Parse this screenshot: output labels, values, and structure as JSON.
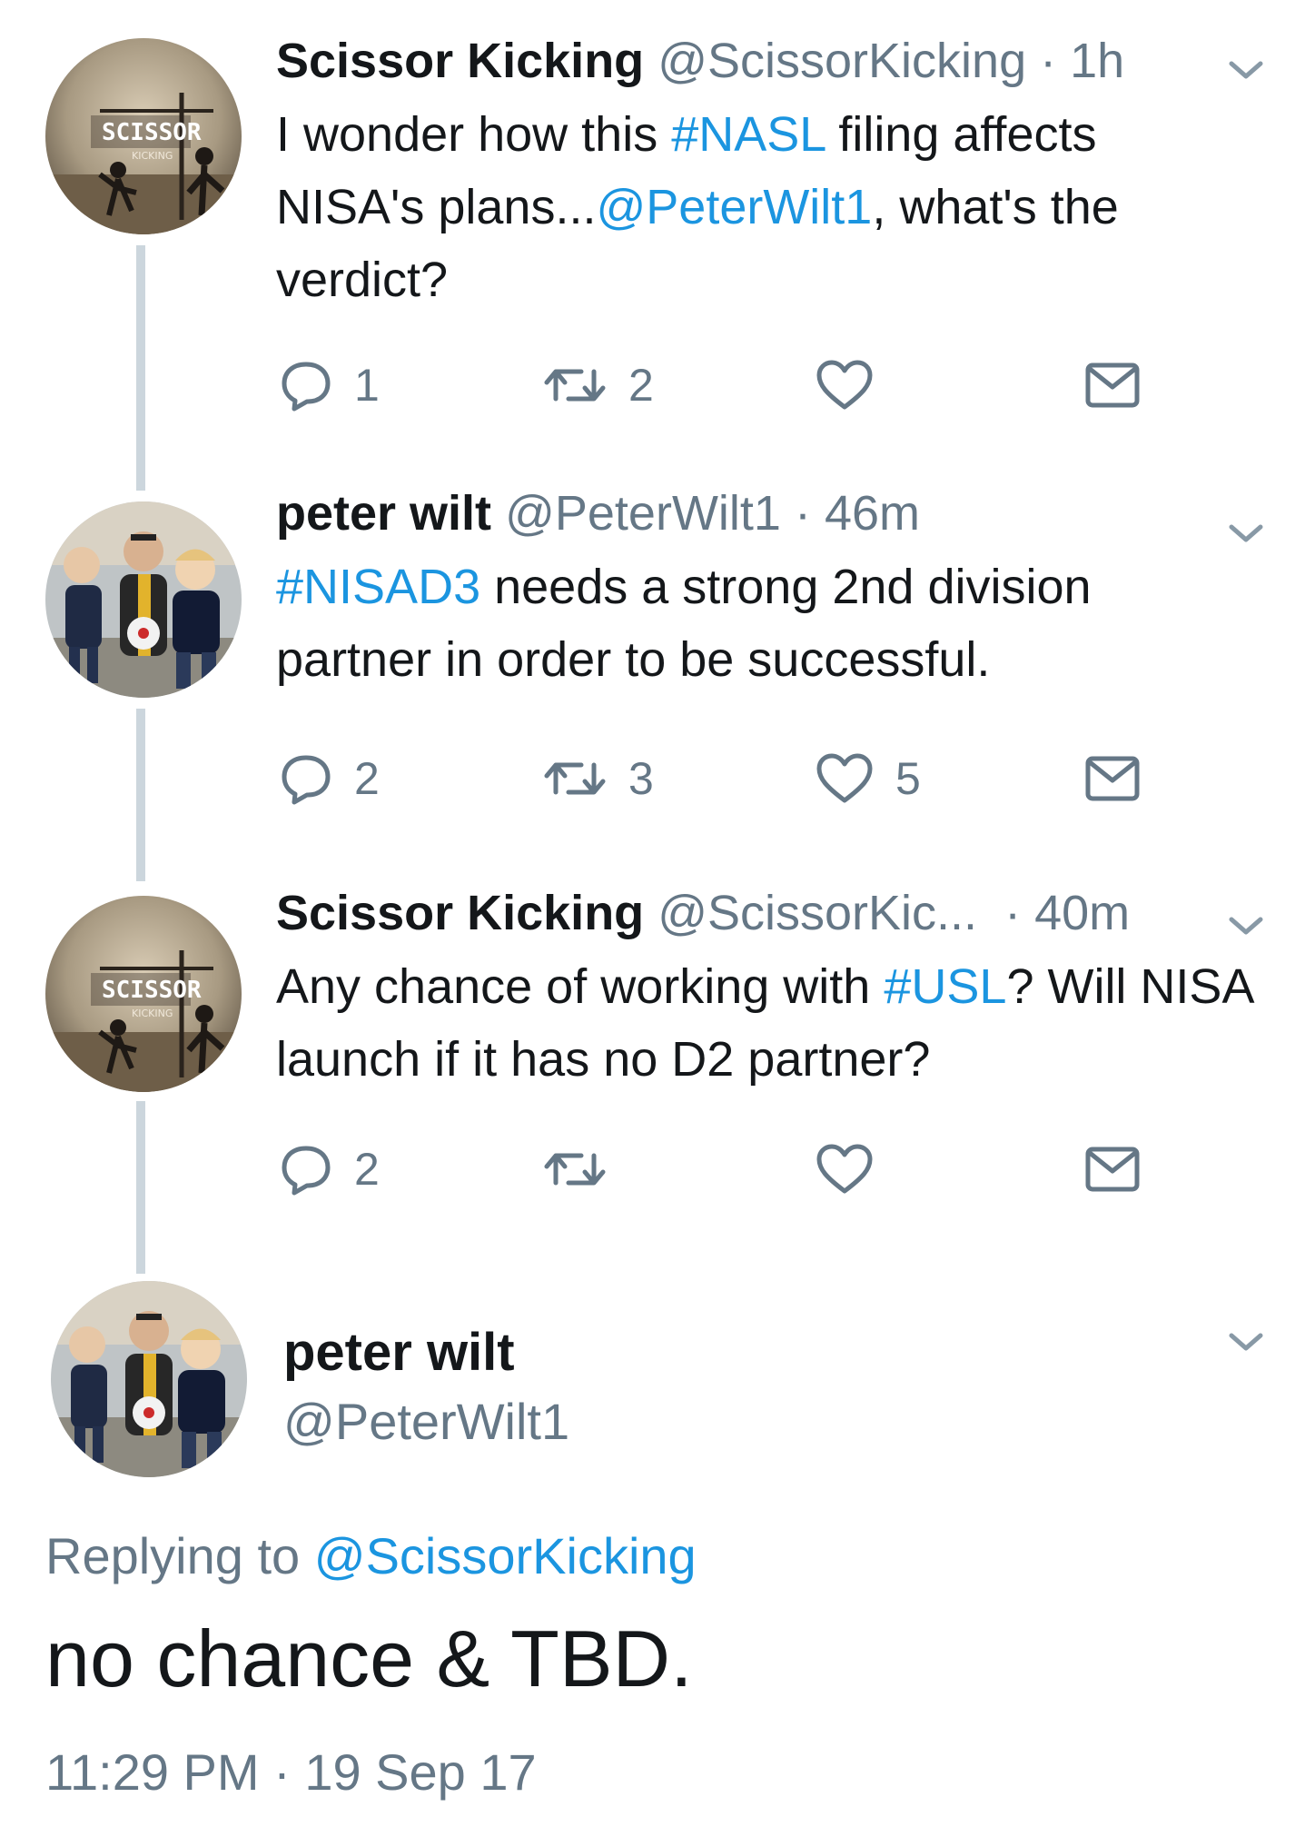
{
  "tweets": [
    {
      "name": "Scissor Kicking",
      "handle": "@ScissorKicking",
      "time": "1h",
      "text": [
        {
          "t": "I wonder how this ",
          "link": false
        },
        {
          "t": "#NASL",
          "link": true
        },
        {
          "t": " filing affects NISA's plans...",
          "link": false
        },
        {
          "t": "@PeterWilt1",
          "link": true
        },
        {
          "t": ", what's the verdict?",
          "link": false
        }
      ],
      "replies": "1",
      "retweets": "2",
      "likes": "",
      "avatar_text": "SCISSOR",
      "avatar_subtext": "KICKING"
    },
    {
      "name": "peter wilt",
      "handle": "@PeterWilt1",
      "time": "46m",
      "text": [
        {
          "t": "#NISAD3",
          "link": true
        },
        {
          "t": " needs a strong 2nd division partner in order to be successful.",
          "link": false
        }
      ],
      "replies": "2",
      "retweets": "3",
      "likes": "5"
    },
    {
      "name": "Scissor Kicking",
      "handle": "@ScissorKic...",
      "time": "40m",
      "text": [
        {
          "t": "Any chance of working with ",
          "link": false
        },
        {
          "t": "#USL",
          "link": true
        },
        {
          "t": "? Will NISA launch if it has no D2 partner?",
          "link": false
        }
      ],
      "replies": "2",
      "retweets": "",
      "likes": "",
      "avatar_text": "SCISSOR",
      "avatar_subtext": "KICKING"
    }
  ],
  "main": {
    "name": "peter wilt",
    "handle": "@PeterWilt1",
    "replying_prefix": "Replying to",
    "replying_to": "@ScissorKicking",
    "text": "no chance & TBD.",
    "time": "11:29 PM",
    "date": "19 Sep 17"
  },
  "colors": {
    "link": "#1b95e0",
    "secondary": "#657786",
    "thread_line": "#ccd6dd"
  },
  "icons": [
    "reply-icon",
    "retweet-icon",
    "like-icon",
    "dm-icon",
    "chevron-down-icon"
  ]
}
